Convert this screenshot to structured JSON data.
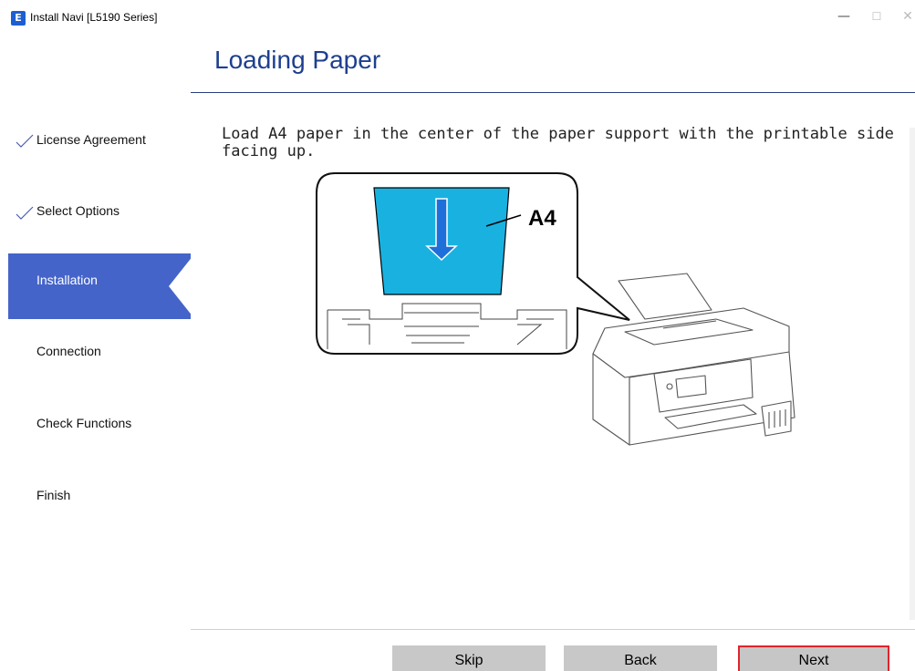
{
  "window": {
    "icon_letter": "E",
    "title": "Install Navi [L5190 Series]",
    "minimize_glyph": "—",
    "maximize_glyph": "☐",
    "close_glyph": "✕"
  },
  "page": {
    "title": "Loading Paper",
    "instruction": "Load A4 paper in the center of the paper support with the printable side facing up."
  },
  "sidebar": {
    "steps": [
      {
        "label": "License Agreement",
        "state": "done"
      },
      {
        "label": "Select Options",
        "state": "done"
      },
      {
        "label": "Installation",
        "state": "active"
      },
      {
        "label": "Connection",
        "state": "pending"
      },
      {
        "label": "Check Functions",
        "state": "pending"
      },
      {
        "label": "Finish",
        "state": "pending"
      }
    ]
  },
  "illustration": {
    "paper_label": "A4",
    "paper_color": "#19b2e0",
    "arrow_color": "#1e6fd9"
  },
  "buttons": {
    "skip": "Skip",
    "back": "Back",
    "next": "Next"
  },
  "colors": {
    "accent": "#4564c9",
    "title": "#1e3f8f",
    "next_border": "#e0242b"
  }
}
